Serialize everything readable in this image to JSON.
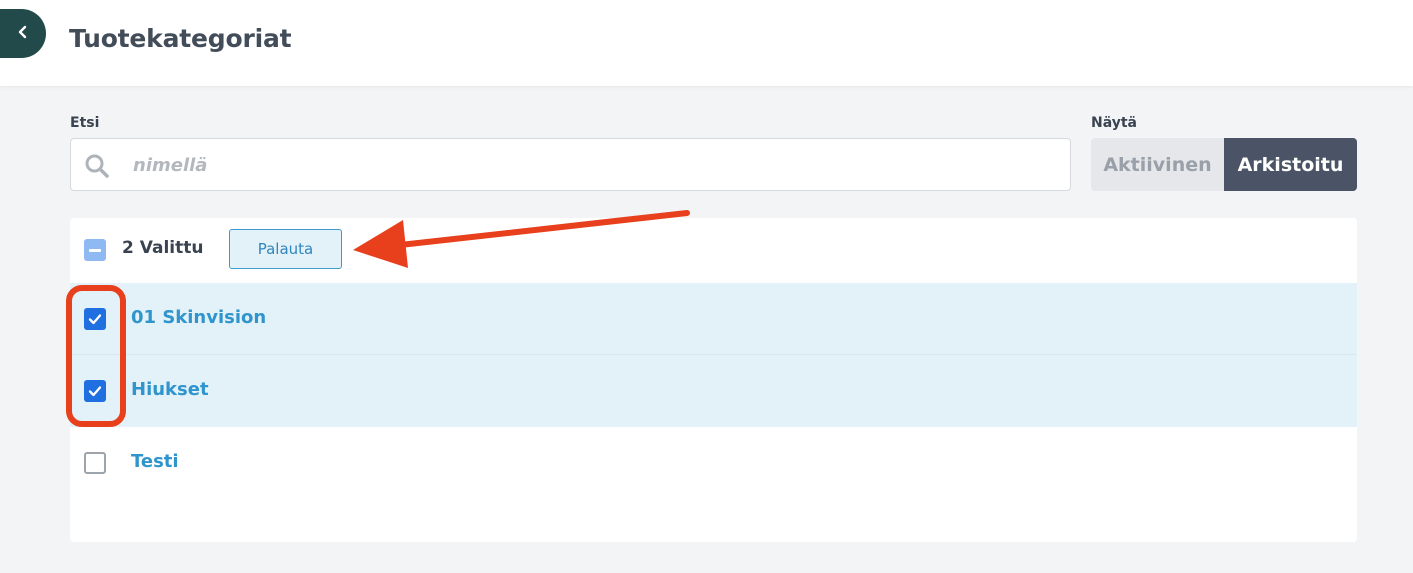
{
  "header": {
    "title": "Tuotekategoriat",
    "back_icon": "chevron-left-icon",
    "back_color": "#234a4a"
  },
  "filters": {
    "search_label": "Etsi",
    "search_placeholder": "nimellä",
    "search_value": "",
    "show_label": "Näytä",
    "show_options": [
      "Aktiivinen",
      "Arkistoitu"
    ],
    "show_selected": "Arkistoitu"
  },
  "toolbar": {
    "selected_count_text": "2 Valittu",
    "restore_label": "Palauta"
  },
  "rows": [
    {
      "label": "01 Skinvision",
      "checked": true
    },
    {
      "label": "Hiukset",
      "checked": true
    },
    {
      "label": "Testi",
      "checked": false
    }
  ],
  "colors": {
    "accent_blue": "#2f95cc",
    "checkbox_blue": "#1f6fe0",
    "selected_row_bg": "#e3f1f8",
    "annotation_red": "#e8401d",
    "toggle_active_bg": "#4a5466"
  }
}
